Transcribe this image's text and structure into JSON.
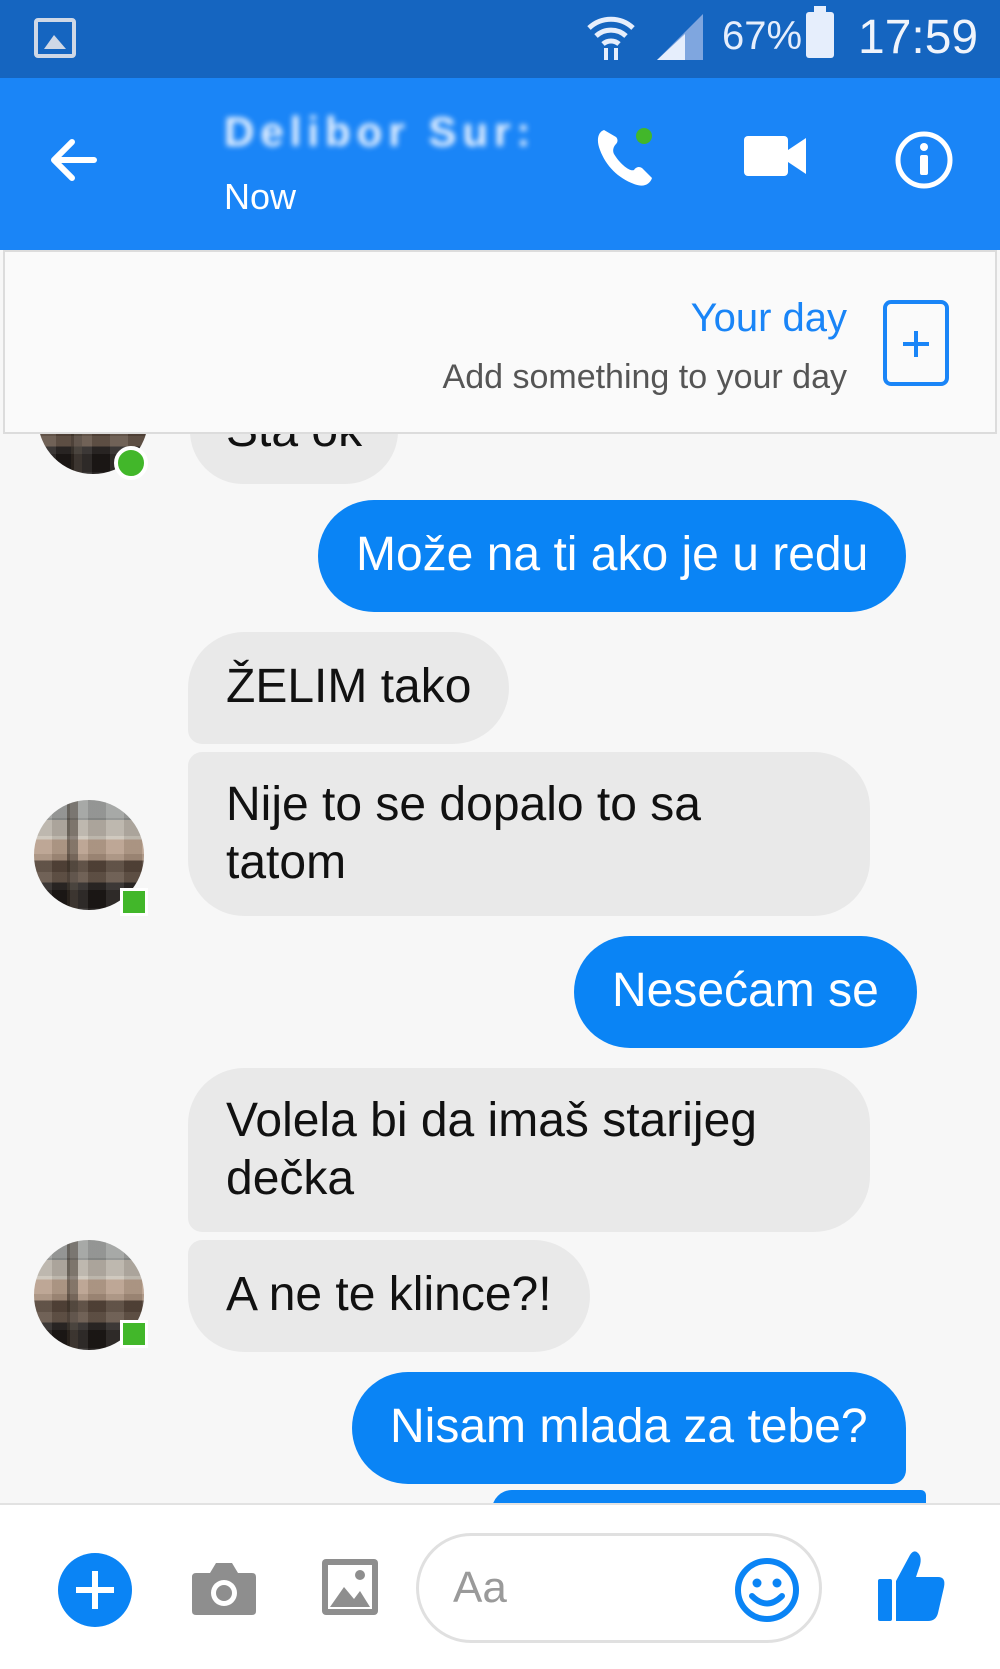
{
  "status_bar": {
    "battery_percent": "67%",
    "time": "17:59"
  },
  "header": {
    "contact_name": "Delibor Sur:",
    "presence": "Now"
  },
  "your_day": {
    "title": "Your day",
    "subtitle": "Add something to your day"
  },
  "messages": [
    {
      "side": "in",
      "text": "Šta ok"
    },
    {
      "side": "out",
      "text": "Može na ti ako je u redu"
    },
    {
      "side": "in",
      "text": "ŽELIM tako"
    },
    {
      "side": "in",
      "text_line1": "Nije to se dopalo to sa",
      "text_line2": "tatom"
    },
    {
      "side": "out",
      "text": "Nesećam se"
    },
    {
      "side": "in",
      "text_line1": "Volela bi da imaš starijeg",
      "text_line2": "dečka"
    },
    {
      "side": "in",
      "text": "A ne te klince?!"
    },
    {
      "side": "out",
      "text": "Nisam mlada za tebe?"
    }
  ],
  "composer": {
    "placeholder": "Aa"
  },
  "colors": {
    "messenger_blue": "#1a85f7",
    "status_bar": "#1565c0",
    "incoming_bubble": "#e9e9e9",
    "online_green": "#42b72a"
  },
  "icons": [
    "gallery-icon",
    "wifi-icon",
    "signal-icon",
    "battery-icon",
    "back-arrow-icon",
    "phone-icon",
    "video-icon",
    "info-icon",
    "plus-icon",
    "camera-icon",
    "image-icon",
    "emoji-icon",
    "thumbs-up-icon"
  ]
}
